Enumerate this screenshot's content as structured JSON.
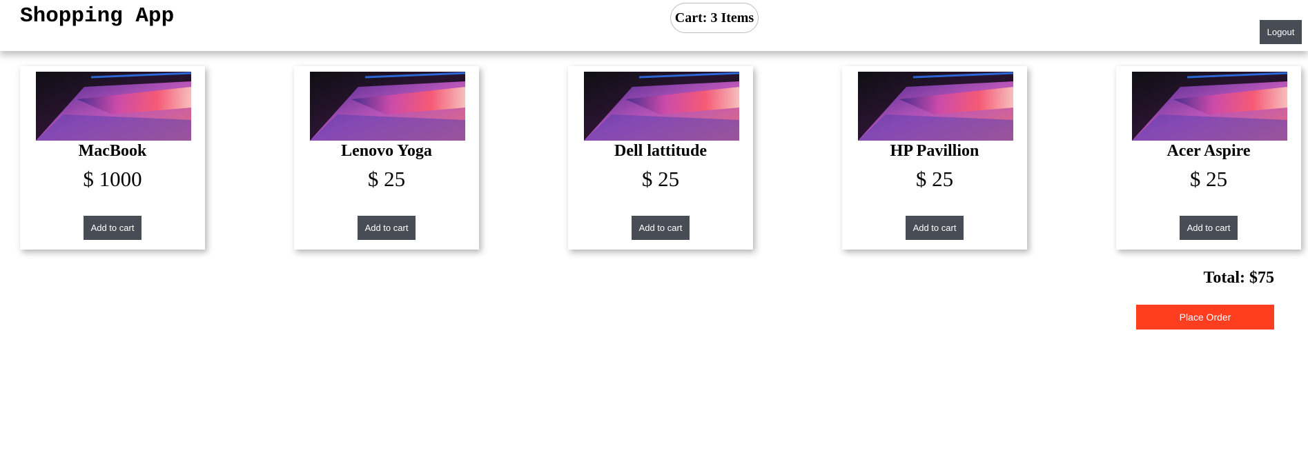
{
  "header": {
    "title": "Shopping App",
    "cart_label": "Cart: 3 Items",
    "logout_label": "Logout"
  },
  "products": [
    {
      "name": "MacBook",
      "price": "$ 1000",
      "button": "Add to cart"
    },
    {
      "name": "Lenovo Yoga",
      "price": "$ 25",
      "button": "Add to cart"
    },
    {
      "name": "Dell lattitude",
      "price": "$ 25",
      "button": "Add to cart"
    },
    {
      "name": "HP Pavillion",
      "price": "$ 25",
      "button": "Add to cart"
    },
    {
      "name": "Acer Aspire",
      "price": "$ 25",
      "button": "Add to cart"
    }
  ],
  "summary": {
    "total_label": "Total: $75",
    "place_order_label": "Place Order"
  },
  "colors": {
    "button_dark": "#474c55",
    "place_order": "#ff3d1f"
  }
}
